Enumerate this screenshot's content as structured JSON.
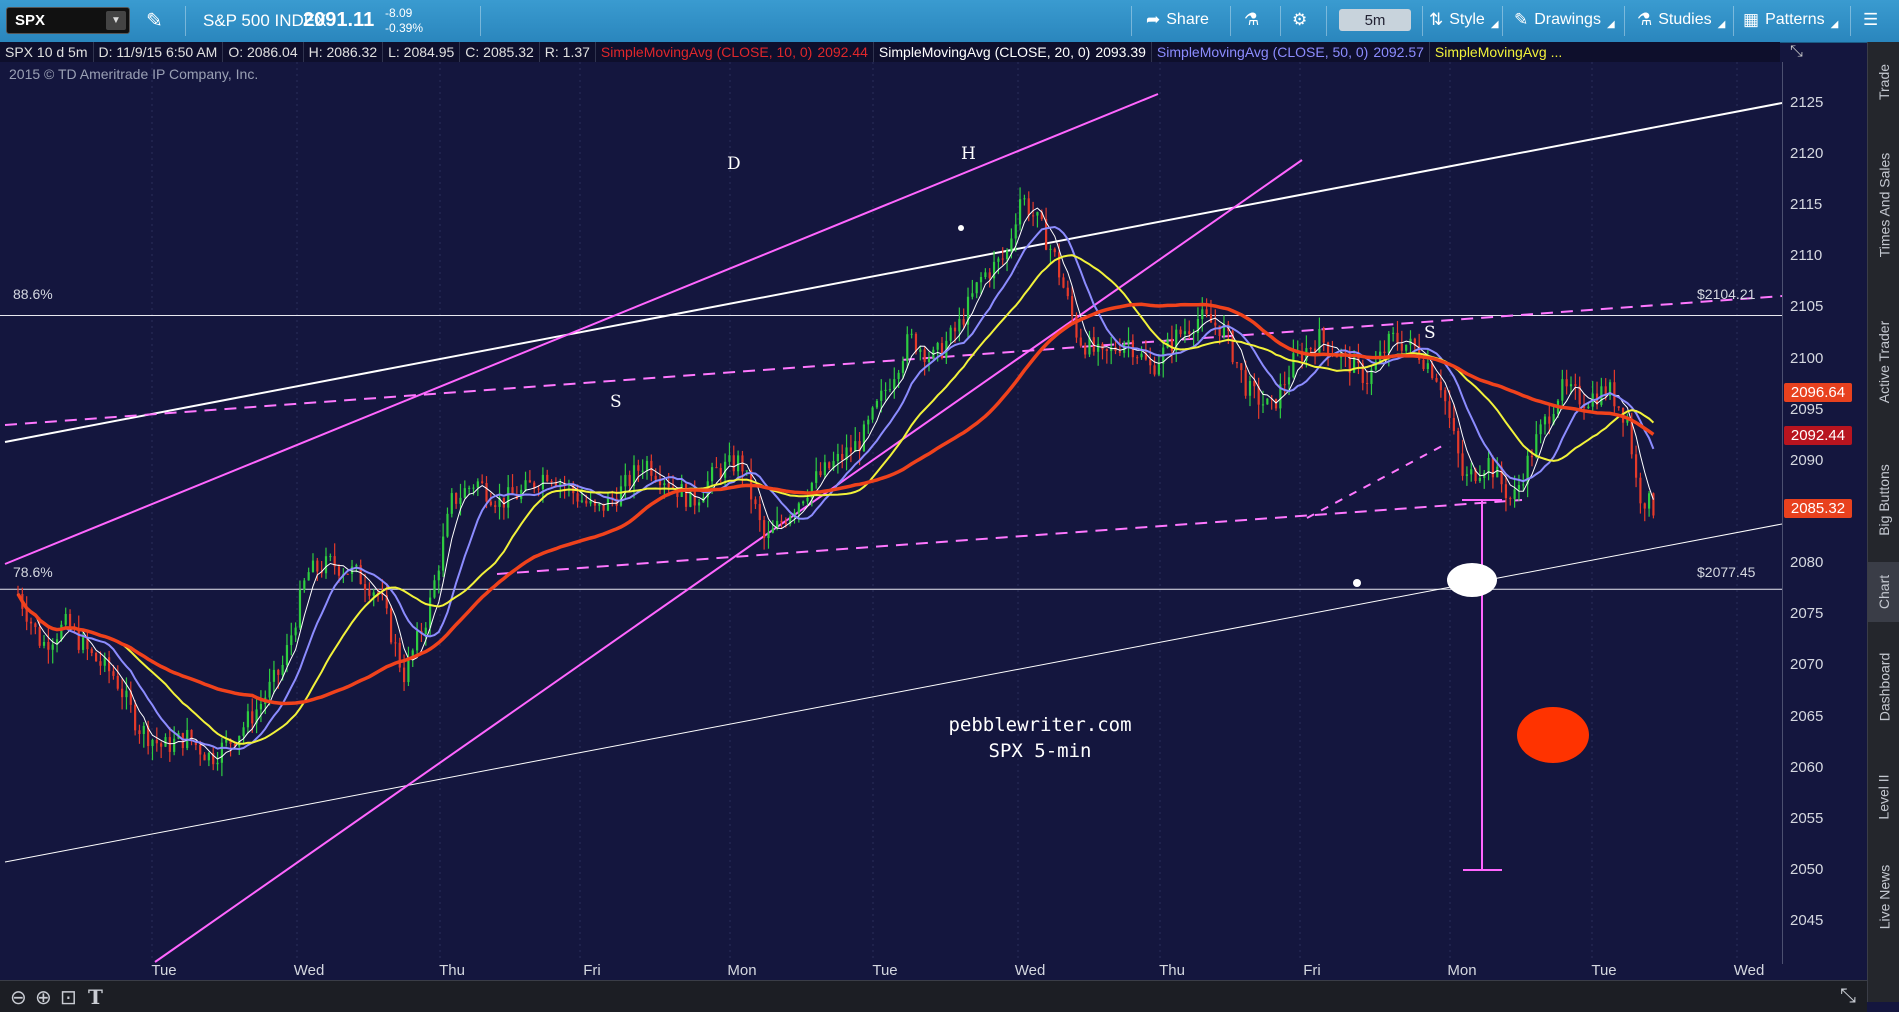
{
  "toolbar": {
    "symbol": "SPX",
    "index_name": "S&P 500 INDEX",
    "price": "2091.11",
    "change": "-8.09",
    "change_pct": "-0.39%",
    "share": "Share",
    "timeframe": "5m",
    "style": "Style",
    "drawings": "Drawings",
    "studies": "Studies",
    "patterns": "Patterns"
  },
  "study_bar": {
    "symbol_period": "SPX 10 d 5m",
    "date": "D: 11/9/15 6:50 AM",
    "open": "O: 2086.04",
    "high": "H: 2086.32",
    "low": "L: 2084.95",
    "close": "C: 2085.32",
    "range": "R: 1.37",
    "sma10_name": "SimpleMovingAvg (CLOSE, 10, 0)",
    "sma10_value": "2092.44",
    "sma20_name": "SimpleMovingAvg (CLOSE, 20, 0)",
    "sma20_value": "2093.39",
    "sma50_name": "SimpleMovingAvg (CLOSE, 50, 0)",
    "sma50_value": "2092.57",
    "sma_more": "SimpleMovingAvg ..."
  },
  "copyright": "2015 © TD Ameritrade IP Company, Inc.",
  "right_tabs": [
    "Trade",
    "Times And Sales",
    "Active Trader",
    "Big Buttons",
    "Chart",
    "Dashboard",
    "Level II",
    "Live News"
  ],
  "chart_data": {
    "type": "candlestick",
    "symbol": "SPX",
    "interval": "5m",
    "ylim": [
      2041,
      2129
    ],
    "y_ticks": [
      2045,
      2050,
      2055,
      2060,
      2065,
      2070,
      2075,
      2080,
      2085,
      2090,
      2095,
      2100,
      2105,
      2110,
      2115,
      2120,
      2125
    ],
    "x_ticks": [
      "Tue",
      "Wed",
      "Thu",
      "Fri",
      "Mon",
      "Tue",
      "Wed",
      "Thu",
      "Fri",
      "Mon",
      "Tue",
      "Wed"
    ],
    "price_tags": [
      {
        "value": "2096.64",
        "color": "#e8411e"
      },
      {
        "value": "2092.44",
        "color": "#b8141f"
      },
      {
        "value": "2085.32",
        "color": "#e8411e"
      }
    ],
    "fib_levels": [
      {
        "label": "88.6%",
        "price_label": "$2104.21",
        "value": 2104.21
      },
      {
        "label": "78.6%",
        "price_label": "$2077.45",
        "value": 2077.45
      }
    ],
    "pattern_labels": [
      "D",
      "H",
      "S",
      "S"
    ],
    "watermark": [
      "pebblewriter.com",
      "SPX 5-min"
    ],
    "price_path": [
      [
        0,
        2077
      ],
      [
        0.5,
        2072
      ],
      [
        1,
        2074
      ],
      [
        1.5,
        2071
      ],
      [
        2,
        2069
      ],
      [
        2.5,
        2064
      ],
      [
        3,
        2062
      ],
      [
        3.5,
        2063
      ],
      [
        4,
        2061
      ],
      [
        4.5,
        2063
      ],
      [
        5,
        2066
      ],
      [
        5.5,
        2070
      ],
      [
        6,
        2079
      ],
      [
        6.5,
        2080
      ],
      [
        7,
        2079
      ],
      [
        7.5,
        2077
      ],
      [
        8,
        2069
      ],
      [
        8.5,
        2075
      ],
      [
        9,
        2086
      ],
      [
        9.5,
        2088
      ],
      [
        10,
        2086
      ],
      [
        10.5,
        2087
      ],
      [
        11,
        2089
      ],
      [
        11.5,
        2087
      ],
      [
        12,
        2085
      ],
      [
        12.5,
        2087
      ],
      [
        13,
        2090
      ],
      [
        13.5,
        2088
      ],
      [
        14,
        2086
      ],
      [
        14.5,
        2089
      ],
      [
        15,
        2090
      ],
      [
        15.5,
        2082
      ],
      [
        16,
        2085
      ],
      [
        16.5,
        2088
      ],
      [
        17,
        2090
      ],
      [
        17.5,
        2092
      ],
      [
        18,
        2097
      ],
      [
        18.5,
        2102
      ],
      [
        19,
        2100
      ],
      [
        19.5,
        2103
      ],
      [
        20,
        2108
      ],
      [
        20.5,
        2110
      ],
      [
        20.8,
        2116
      ],
      [
        21.2,
        2113
      ],
      [
        21.5,
        2110
      ],
      [
        22,
        2102
      ],
      [
        22.5,
        2100
      ],
      [
        23,
        2102
      ],
      [
        23.5,
        2099
      ],
      [
        24,
        2102
      ],
      [
        24.5,
        2104
      ],
      [
        25,
        2103
      ],
      [
        25.5,
        2097
      ],
      [
        26,
        2095
      ],
      [
        26.5,
        2100
      ],
      [
        27,
        2102
      ],
      [
        27.5,
        2100
      ],
      [
        28,
        2098
      ],
      [
        28.5,
        2102
      ],
      [
        29,
        2101
      ],
      [
        29.5,
        2098
      ],
      [
        30,
        2088
      ],
      [
        30.5,
        2090
      ],
      [
        31,
        2086
      ],
      [
        31.5,
        2092
      ],
      [
        32,
        2097
      ],
      [
        32.5,
        2096
      ],
      [
        33,
        2097
      ],
      [
        33.4,
        2094
      ],
      [
        33.6,
        2087
      ],
      [
        34,
        2085
      ]
    ]
  }
}
